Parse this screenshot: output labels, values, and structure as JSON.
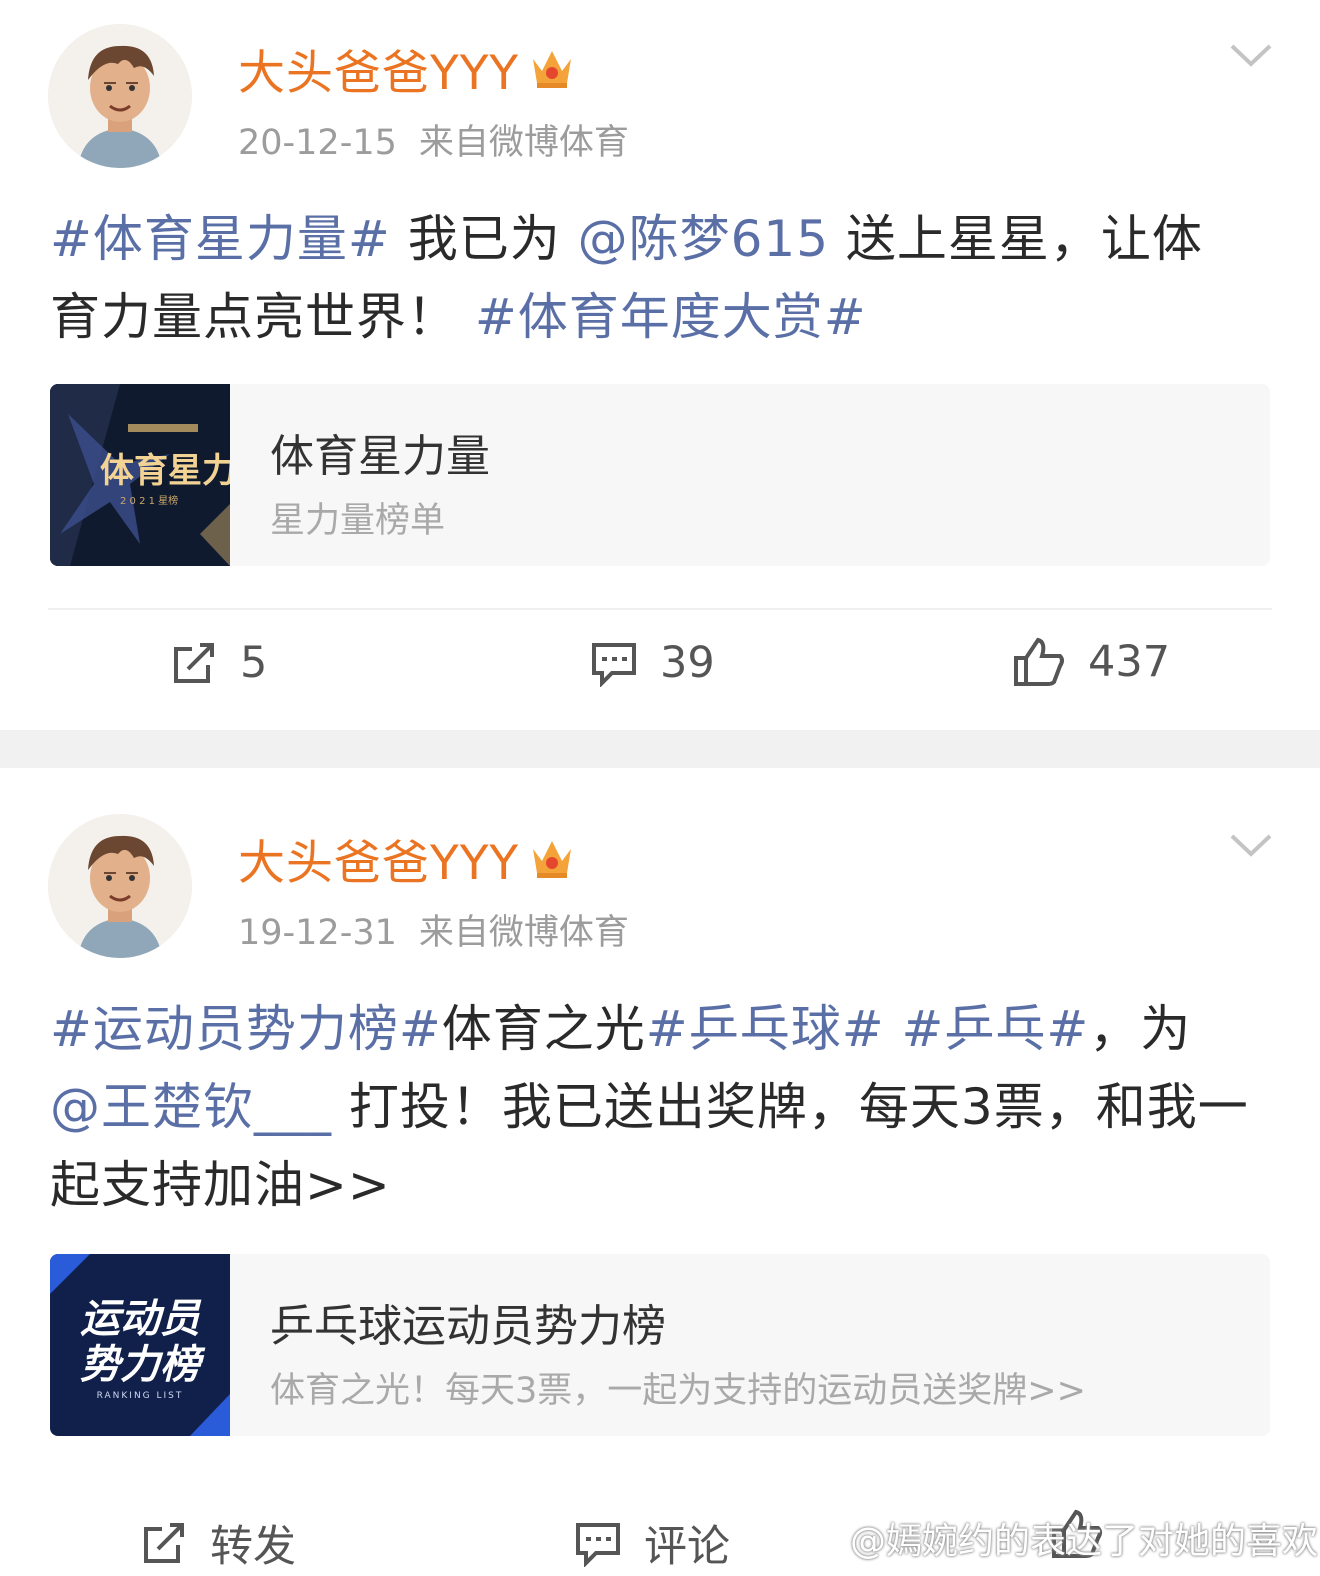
{
  "posts": [
    {
      "username": "大头爸爸YYY",
      "date": "20-12-15",
      "source": "来自微博体育",
      "text_parts": [
        {
          "t": "#体育星力量#",
          "tag": true
        },
        {
          "t": " 我已为 ",
          "tag": false
        },
        {
          "t": "@陈梦615",
          "tag": true
        },
        {
          "t": " 送上星星，让体育力量点亮世界！ ",
          "tag": false
        },
        {
          "t": "#体育年度大赏#",
          "tag": true
        }
      ],
      "card": {
        "title": "体育星力量",
        "subtitle": "星力量榜单",
        "thumb_text": "体育星力",
        "thumb_year": "2 0 2 1 星榜"
      },
      "actions": {
        "repost": "5",
        "comment": "39",
        "like": "437"
      }
    },
    {
      "username": "大头爸爸YYY",
      "date": "19-12-31",
      "source": "来自微博体育",
      "text_parts": [
        {
          "t": "#运动员势力榜#",
          "tag": true
        },
        {
          "t": "体育之光",
          "tag": false
        },
        {
          "t": "#乒乓球#",
          "tag": true
        },
        {
          "t": " ",
          "tag": false
        },
        {
          "t": "#乒乓#",
          "tag": true
        },
        {
          "t": "，为 ",
          "tag": false
        },
        {
          "t": "@王楚钦___",
          "tag": true
        },
        {
          "t": " 打投！我已送出奖牌，每天3票，和我一起支持加油>>",
          "tag": false
        }
      ],
      "card": {
        "title": "乒乓球运动员势力榜",
        "subtitle": "体育之光！每天3票，一起为支持的运动员送奖牌>>",
        "thumb_line1": "运动员",
        "thumb_line2": "势力榜",
        "thumb_small": "RANKING LIST"
      },
      "actions": {
        "repost": "转发",
        "comment": "评论"
      }
    }
  ],
  "watermark": "@嫣婉约的表达了对她的喜欢",
  "colors": {
    "username": "#eb7422",
    "tag": "#5b6fa7",
    "meta": "#9c9c9c",
    "gap": "#f1f1f1"
  }
}
